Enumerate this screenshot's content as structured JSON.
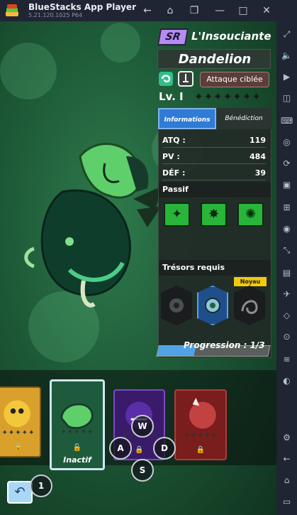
{
  "emulator": {
    "app_name": "BlueStacks App Player",
    "version": "5.21.120.1025 P64"
  },
  "hero": {
    "rarity": "SR",
    "title": "L'Insouciante",
    "name": "Dandelion",
    "role": "Attaque ciblée",
    "level": "Lv. I",
    "stars": "✦✦✦✦✦✦✦"
  },
  "tabs": {
    "info": "Informations",
    "blessing": "Bénédiction"
  },
  "stats": [
    {
      "label": "ATQ :",
      "value": "119"
    },
    {
      "label": "PV :",
      "value": "484"
    },
    {
      "label": "DÉF :",
      "value": "39"
    }
  ],
  "passive": {
    "title": "Passif",
    "skills": [
      "skill-1-icon",
      "skill-2-icon",
      "skill-3-icon"
    ]
  },
  "treasures": {
    "title": "Trésors requis",
    "core_label": "Noyau"
  },
  "progress": {
    "label": "Progression : 1/3",
    "fraction": 0.333
  },
  "roster": {
    "inactive_label": "Inactif",
    "lock_icon": "lock-icon"
  },
  "keys": {
    "w": "W",
    "a": "A",
    "s": "S",
    "d": "D",
    "one": "1"
  },
  "colors": {
    "accent_blue": "#2f7bd6",
    "sr_purple": "#b48cf2",
    "skill_green": "#28b53a",
    "core_yellow": "#f2c90e"
  }
}
